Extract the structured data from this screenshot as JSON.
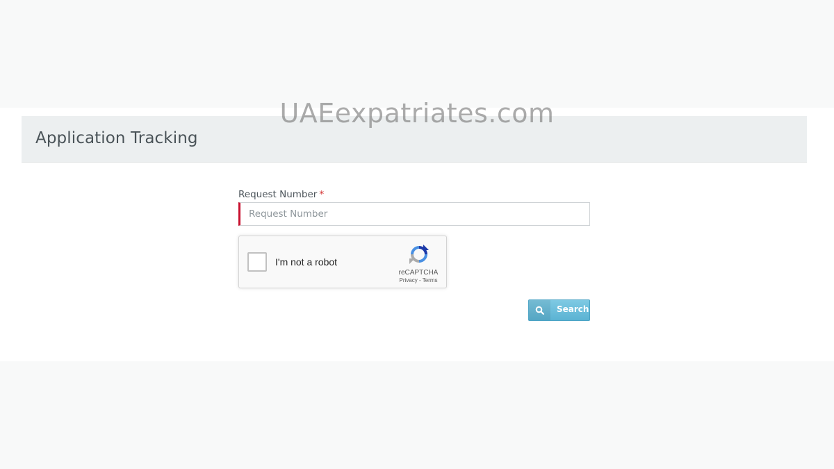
{
  "watermark": "UAEexpatriates.com",
  "header": {
    "title": "Application Tracking"
  },
  "form": {
    "request_label": "Request Number",
    "required_marker": "*",
    "request_placeholder": "Request Number",
    "request_value": ""
  },
  "captcha": {
    "label": "I'm not a robot",
    "brand": "reCAPTCHA",
    "links": "Privacy - Terms",
    "checked": false
  },
  "actions": {
    "search_label": "Search",
    "search_icon": "search-icon",
    "button_color": "#6bbfdc"
  },
  "colors": {
    "required": "#d32f2f",
    "input_accent": "#c8102e",
    "header_bg": "#eceff0"
  }
}
